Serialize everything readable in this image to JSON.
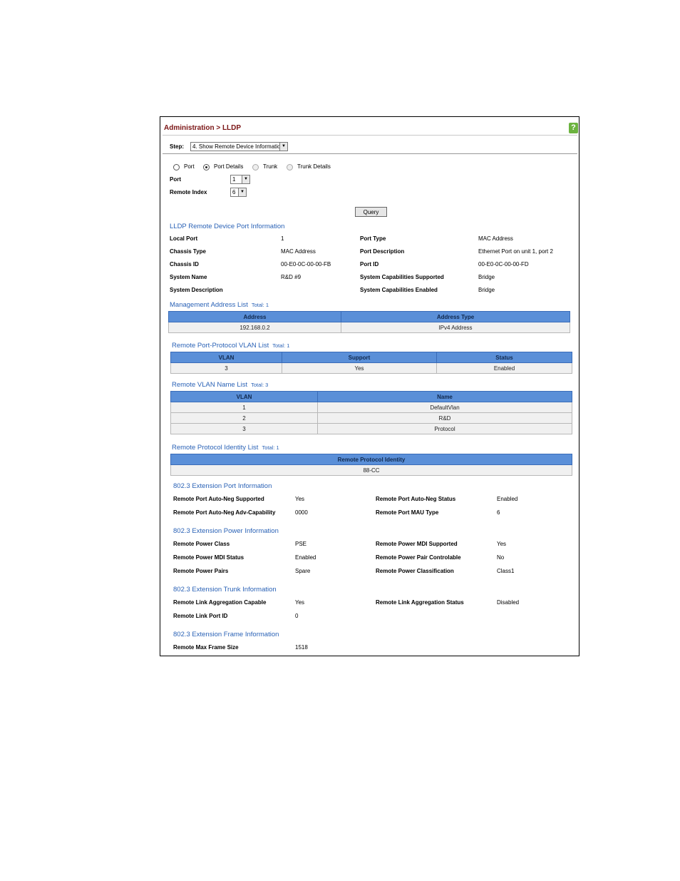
{
  "header": {
    "title": "Administration > LLDP",
    "help_icon": "?"
  },
  "step": {
    "label": "Step:",
    "selected": "4. Show Remote Device Information"
  },
  "mode_options": [
    "Port",
    "Port Details",
    "Trunk",
    "Trunk Details"
  ],
  "port": {
    "label": "Port",
    "value": "1"
  },
  "remote_index": {
    "label": "Remote Index",
    "value": "6"
  },
  "query_button": "Query",
  "port_info": {
    "title": "LLDP Remote Device Port Information",
    "left": [
      {
        "label": "Local Port",
        "value": "1"
      },
      {
        "label": "Chassis Type",
        "value": "MAC Address"
      },
      {
        "label": "Chassis ID",
        "value": "00-E0-0C-00-00-FB"
      },
      {
        "label": "System Name",
        "value": "R&D #9"
      },
      {
        "label": "System Description",
        "value": ""
      }
    ],
    "right": [
      {
        "label": "Port Type",
        "value": "MAC Address"
      },
      {
        "label": "Port Description",
        "value": "Ethernet Port on unit 1, port 2"
      },
      {
        "label": "Port ID",
        "value": "00-E0-0C-00-00-FD"
      },
      {
        "label": "System Capabilities Supported",
        "value": "Bridge"
      },
      {
        "label": "System Capabilities Enabled",
        "value": "Bridge"
      }
    ]
  },
  "mgmt_list": {
    "title": "Management Address List",
    "total": "Total: 1",
    "headers": [
      "Address",
      "Address Type"
    ],
    "rows": [
      [
        "192.168.0.2",
        "IPv4 Address"
      ]
    ]
  },
  "vlan_proto_list": {
    "title": "Remote Port-Protocol VLAN List",
    "total": "Total: 1",
    "headers": [
      "VLAN",
      "Support",
      "Status"
    ],
    "rows": [
      [
        "3",
        "Yes",
        "Enabled"
      ]
    ]
  },
  "vlan_name_list": {
    "title": "Remote VLAN Name List",
    "total": "Total: 3",
    "headers": [
      "VLAN",
      "Name"
    ],
    "rows": [
      [
        "1",
        "DefaultVlan"
      ],
      [
        "2",
        "R&D"
      ],
      [
        "3",
        "Protocol"
      ]
    ]
  },
  "proto_identity_list": {
    "title": "Remote Protocol Identity List",
    "total": "Total: 1",
    "headers": [
      "Remote Protocol Identity"
    ],
    "rows": [
      [
        "88-CC"
      ]
    ]
  },
  "ext_port": {
    "title": "802.3 Extension Port Information",
    "rows": [
      {
        "l1": "Remote Port Auto-Neg Supported",
        "v1": "Yes",
        "l2": "Remote Port Auto-Neg Status",
        "v2": "Enabled"
      },
      {
        "l1": "Remote Port Auto-Neg Adv-Capability",
        "v1": "0000",
        "l2": "Remote Port MAU Type",
        "v2": "6"
      }
    ]
  },
  "ext_power": {
    "title": "802.3 Extension Power Information",
    "rows": [
      {
        "l1": "Remote Power Class",
        "v1": "PSE",
        "l2": "Remote Power MDI Supported",
        "v2": "Yes"
      },
      {
        "l1": "Remote Power MDI Status",
        "v1": "Enabled",
        "l2": "Remote Power Pair Controlable",
        "v2": "No"
      },
      {
        "l1": "Remote Power Pairs",
        "v1": "Spare",
        "l2": "Remote Power Classification",
        "v2": "Class1"
      }
    ]
  },
  "ext_trunk": {
    "title": "802.3 Extension Trunk Information",
    "rows": [
      {
        "l1": "Remote Link Aggregation Capable",
        "v1": "Yes",
        "l2": "Remote Link Aggregation Status",
        "v2": "Disabled"
      },
      {
        "l1": "Remote Link Port ID",
        "v1": "0",
        "l2": "",
        "v2": ""
      }
    ]
  },
  "ext_frame": {
    "title": "802.3 Extension Frame Information",
    "rows": [
      {
        "l1": "Remote Max Frame Size",
        "v1": "1518",
        "l2": "",
        "v2": ""
      }
    ]
  }
}
